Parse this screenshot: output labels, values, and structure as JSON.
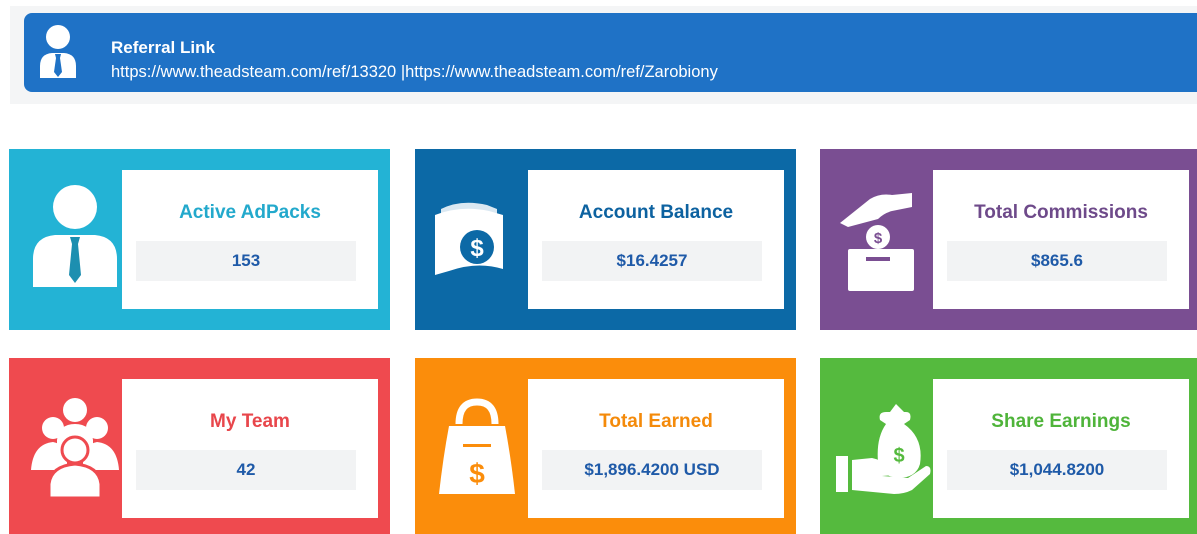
{
  "referral": {
    "title": "Referral Link",
    "links": "https://www.theadsteam.com/ref/13320 |https://www.theadsteam.com/ref/Zarobiony",
    "icon": "user-tie-icon"
  },
  "cards": {
    "adpacks": {
      "label": "Active AdPacks",
      "value": "153",
      "icon": "user-tie-icon",
      "color": "#23b3d5"
    },
    "balance": {
      "label": "Account Balance",
      "value": "$16.4257",
      "icon": "money-bills-icon",
      "color": "#0c69a6"
    },
    "commissions": {
      "label": "Total Commissions",
      "value": "$865.6",
      "icon": "coin-drop-box-icon",
      "color": "#7a4e92"
    },
    "team": {
      "label": "My Team",
      "value": "42",
      "icon": "team-group-icon",
      "color": "#ef4a4f"
    },
    "earned": {
      "label": "Total Earned",
      "value": "$1,896.4200 USD",
      "icon": "money-bag-icon",
      "color": "#fb8d0b"
    },
    "share": {
      "label": "Share Earnings",
      "value": "$1,044.8200",
      "icon": "hand-money-bag-icon",
      "color": "#55ba3e"
    }
  }
}
